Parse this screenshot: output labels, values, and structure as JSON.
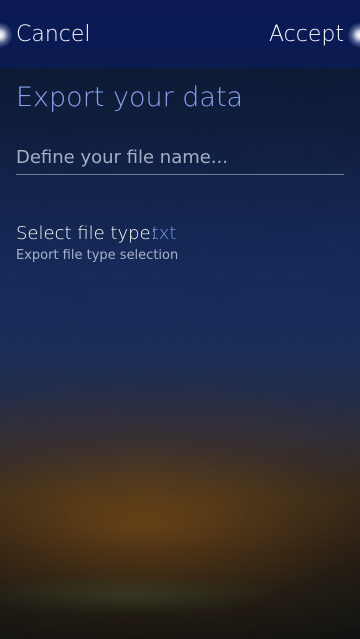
{
  "header": {
    "cancel_label": "Cancel",
    "accept_label": "Accept"
  },
  "page": {
    "title": "Export your data"
  },
  "filename": {
    "value": "",
    "placeholder": "Define your file name..."
  },
  "filetype": {
    "label": "Select file type:",
    "value": ".txt",
    "description": "Export file type selection"
  },
  "colors": {
    "header_bg": "#0b1a52",
    "title": "#8aa3f0",
    "accent_value": "#7f9bf0",
    "text": "#ffffff"
  }
}
